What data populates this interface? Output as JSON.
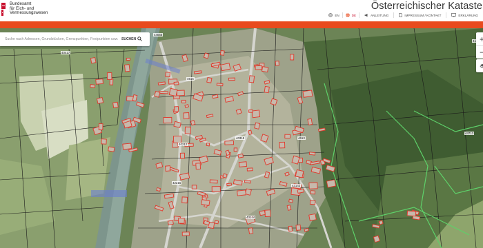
{
  "agency": {
    "line1": "Bundesamt",
    "line2": "für Eich- und",
    "line3": "Vermessungswesen"
  },
  "app_title": "Österreichischer Kataster",
  "nav": {
    "lang_en": "EN",
    "lang_de": "DE",
    "guide": "ANLEITUNG",
    "imprint": "IMPRESSUM / KONTAKT",
    "accessibility": "ERKLÄRUNG"
  },
  "search": {
    "placeholder": "Suche nach Adressen, Grundstücken, Grenzpunkten, Festpunkten usw.",
    "button": "SUCHEN"
  },
  "zoom": {
    "in": "+",
    "out": "−"
  },
  "parcel_labels": [
    "40417",
    "44055",
    "4615",
    "4100",
    "40315",
    "40212",
    "42215",
    "43143",
    "43144",
    "44713",
    "4613"
  ],
  "colors": {
    "accent": "#e84a1e",
    "brand_red": "#c8102e",
    "parcel_line": "#1a1a1a",
    "building_outline": "#e0392b",
    "forest_boundary": "#5ed16a",
    "river": "#8aa39a",
    "road": "#cfcfc9",
    "meadow": "#b6c49a"
  },
  "icons": [
    "globe-icon",
    "megaphone-icon",
    "file-icon",
    "monitor-icon",
    "search-icon",
    "layers-icon"
  ]
}
